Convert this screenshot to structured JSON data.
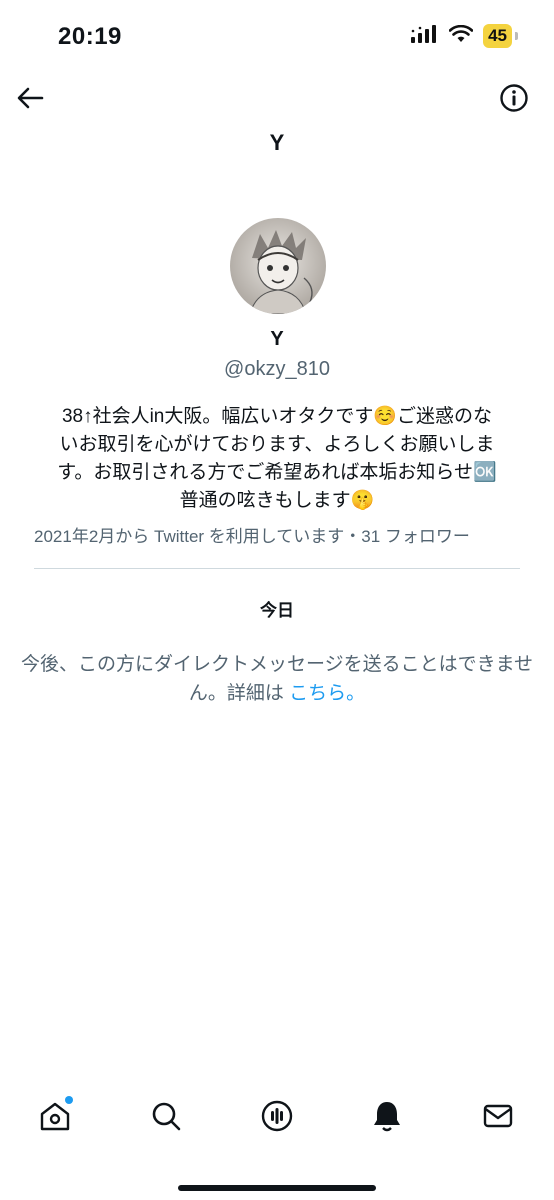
{
  "status_bar": {
    "time": "20:19",
    "battery": "45",
    "icons": [
      "signal-icon",
      "wifi-icon",
      "battery-icon"
    ]
  },
  "nav": {
    "back_icon": "back-arrow-icon",
    "info_icon": "info-icon"
  },
  "header": {
    "title": "Y"
  },
  "profile": {
    "display_name": "Y",
    "handle": "@okzy_810",
    "bio_line1": "38↑社会人in大阪。幅広いオタクです☺️ご迷惑のな",
    "bio_line2": "いお取引を心がけております、よろしくお願いしま",
    "bio_line3": "す。お取引される方でご希望あれば本垢お知らせ🆗",
    "bio_line4": "普通の呟きもします🤫",
    "meta": "2021年2月から Twitter を利用しています・31 フォロワー"
  },
  "conversation": {
    "date_label": "今日",
    "notice_text": "今後、この方にダイレクトメッセージを送ることはできません。詳細は ",
    "notice_link": "こちら。"
  },
  "tab_bar": {
    "tabs": [
      "home-icon",
      "search-icon",
      "spaces-icon",
      "notifications-icon",
      "messages-icon"
    ]
  },
  "colors": {
    "accent": "#1d9bf0",
    "secondary_text": "#536471",
    "battery": "#f4d33f"
  }
}
